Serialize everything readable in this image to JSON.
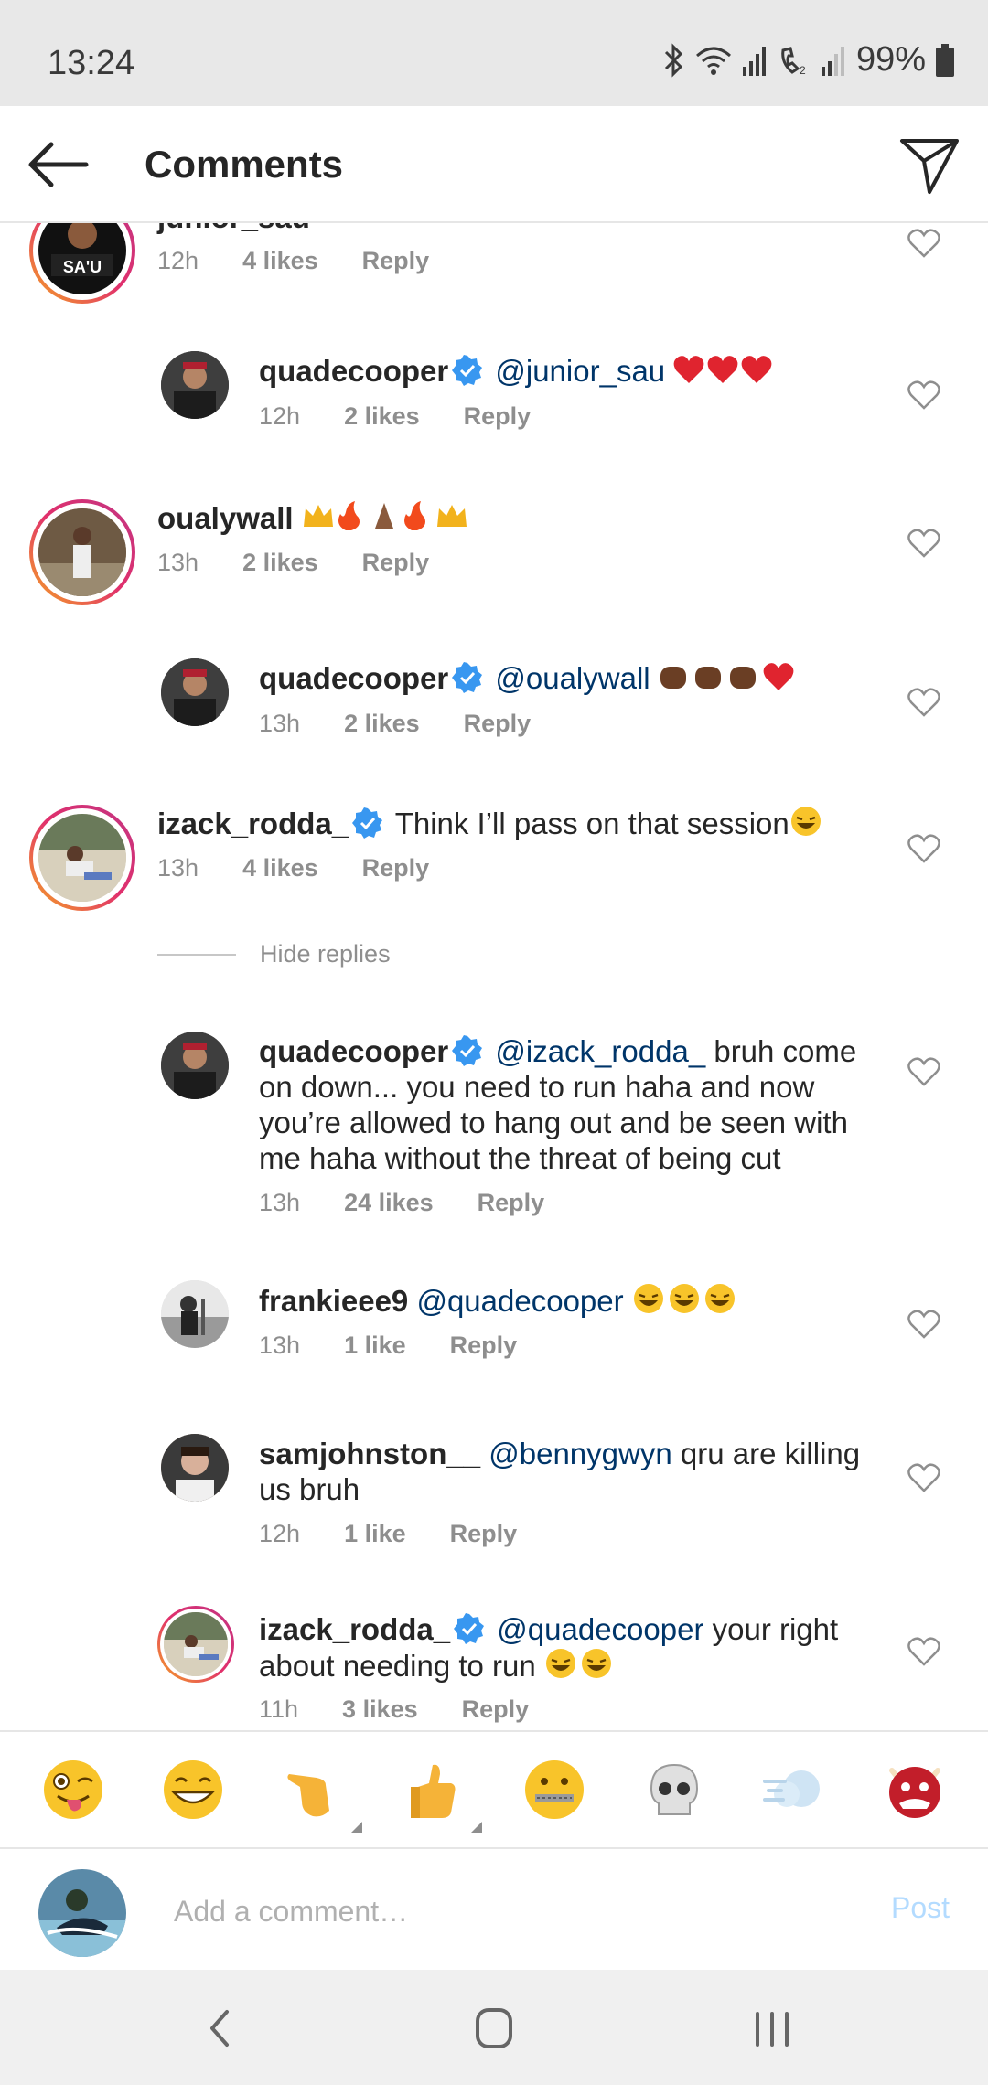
{
  "status_bar": {
    "time": "13:24",
    "battery": "99%"
  },
  "header": {
    "title": "Comments"
  },
  "comments": [
    {
      "user": "junior_sau",
      "verified": true,
      "text": "",
      "time": "12h",
      "likes": "4 likes",
      "reply": "Reply"
    },
    {
      "user": "quadecooper",
      "verified": true,
      "mention": "@junior_sau",
      "text": "",
      "time": "12h",
      "likes": "2 likes",
      "reply": "Reply"
    },
    {
      "user": "oualywall",
      "verified": false,
      "text": "",
      "time": "13h",
      "likes": "2 likes",
      "reply": "Reply"
    },
    {
      "user": "quadecooper",
      "verified": true,
      "mention": "@oualywall",
      "text": "",
      "time": "13h",
      "likes": "2 likes",
      "reply": "Reply"
    },
    {
      "user": "izack_rodda_",
      "verified": true,
      "text": "Think I’ll pass on that session",
      "time": "13h",
      "likes": "4 likes",
      "reply": "Reply"
    },
    {
      "user": "quadecooper",
      "verified": true,
      "mention": "@izack_rodda_",
      "text_line1": "bruh come",
      "text_line2": "on down... you need to run haha and now",
      "text_line3": "you’re allowed to hang out and be seen with",
      "text_line4": "me haha without the threat of being cut",
      "time": "13h",
      "likes": "24 likes",
      "reply": "Reply"
    },
    {
      "user": "frankieee9",
      "verified": false,
      "mention": "@quadecooper",
      "text": "",
      "time": "13h",
      "likes": "1 like",
      "reply": "Reply"
    },
    {
      "user": "samjohnston__",
      "verified": false,
      "mention": "@bennygwyn",
      "text_line1": "qru are killing",
      "text_line2": "us bruh",
      "time": "12h",
      "likes": "1 like",
      "reply": "Reply"
    },
    {
      "user": "izack_rodda_",
      "verified": true,
      "mention": "@quadecooper",
      "text_line1": "your right",
      "text_line2": "about needing to run",
      "time": "11h",
      "likes": "3 likes",
      "reply": "Reply"
    }
  ],
  "hide_replies": "Hide replies",
  "emoji_bar": [
    "winking-tongue-emoji",
    "grinning-emoji",
    "pointing-hand-emoji",
    "thumbs-up-emoji",
    "zipper-mouth-emoji",
    "skull-emoji",
    "dash-emoji",
    "ogre-emoji"
  ],
  "composer": {
    "placeholder": "Add a comment…",
    "post_label": "Post"
  },
  "colors": {
    "mention": "#003569",
    "meta": "#8e8e8e",
    "verified": "#3897f0",
    "post_disabled": "#b3dbff"
  }
}
